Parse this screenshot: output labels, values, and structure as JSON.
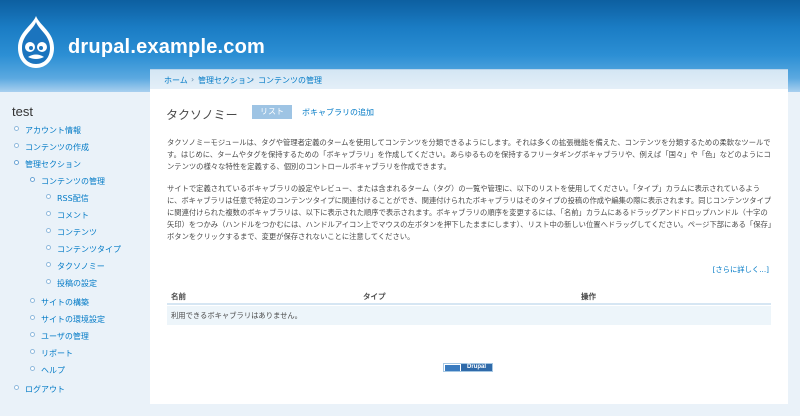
{
  "header": {
    "site_name": "drupal.example.com",
    "logo": "drupal-drop-logo"
  },
  "sidebar": {
    "title": "test",
    "items": [
      {
        "label": "アカウント情報",
        "depth": 0
      },
      {
        "label": "コンテンツの作成",
        "depth": 0
      },
      {
        "label": "管理セクション",
        "depth": 0
      },
      {
        "label": "コンテンツの管理",
        "depth": 1
      },
      {
        "label": "RSS配信",
        "depth": 2
      },
      {
        "label": "コメント",
        "depth": 2
      },
      {
        "label": "コンテンツ",
        "depth": 2
      },
      {
        "label": "コンテンツタイプ",
        "depth": 2
      },
      {
        "label": "タクソノミー",
        "depth": 2
      },
      {
        "label": "投稿の設定",
        "depth": 2
      },
      {
        "label": "サイトの構築",
        "depth": 1
      },
      {
        "label": "サイトの環境設定",
        "depth": 1
      },
      {
        "label": "ユーザの管理",
        "depth": 1
      },
      {
        "label": "リポート",
        "depth": 1
      },
      {
        "label": "ヘルプ",
        "depth": 1
      },
      {
        "label": "ログアウト",
        "depth": 0
      }
    ]
  },
  "breadcrumb": {
    "items": [
      "ホーム",
      "管理セクション",
      "コンテンツの管理"
    ],
    "separator": "›"
  },
  "main": {
    "title": "タクソノミー",
    "tabs": {
      "list": "リスト",
      "add_vocabulary": "ボキャブラリの追加"
    },
    "paragraphs": [
      "タクソノミーモジュールは、タグや管理者定義のタームを使用してコンテンツを分類できるようにします。それは多くの拡張機能を備えた、コンテンツを分類するための柔軟なツールです。はじめに、タームやタグを保持するための「ボキャブラリ」を作成してください。あらゆるものを保持するフリータギングボキャブラリや、例えば「国々」や「色」などのようにコンテンツの様々な特性を定義する、個別のコントロールボキャブラリを作成できます。",
      "サイトで定義されているボキャブラリの設定やレビュー、または含まれるターム（タグ）の一覧や管理に、以下のリストを使用してください。「タイプ」カラムに表示されているように、ボキャブラリは任意で特定のコンテンツタイプに関連付けることができ、関連付けられたボキャブラリはそのタイプの投稿の作成や編集の際に表示されます。同じコンテンツタイプに関連付けられた複数のボキャブラリは、以下に表示された順序で表示されます。ボキャブラリの順序を変更するには、「名前」カラムにあるドラッグアンドドロップハンドル（十字の矢印）をつかみ（ハンドルをつかむには、ハンドルアイコン上でマウスの左ボタンを押下したままにします）、リスト中の新しい位置へドラッグしてください。ページ下部にある「保存」ボタンをクリックするまで、変更が保存されないことに注意してください。"
    ],
    "more_help": "[さらに詳しく...]",
    "table": {
      "columns": [
        "名前",
        "タイプ",
        "操作"
      ],
      "empty_message": "利用できるボキャブラリはありません。"
    },
    "footer_badge": "Drupal"
  },
  "colors": {
    "link": "#027ac6",
    "header_top": "#0d5fa0",
    "header_bottom": "#a9d0ef",
    "page_bg": "#eaf2f9",
    "active_tab": "#9ec4e4"
  }
}
